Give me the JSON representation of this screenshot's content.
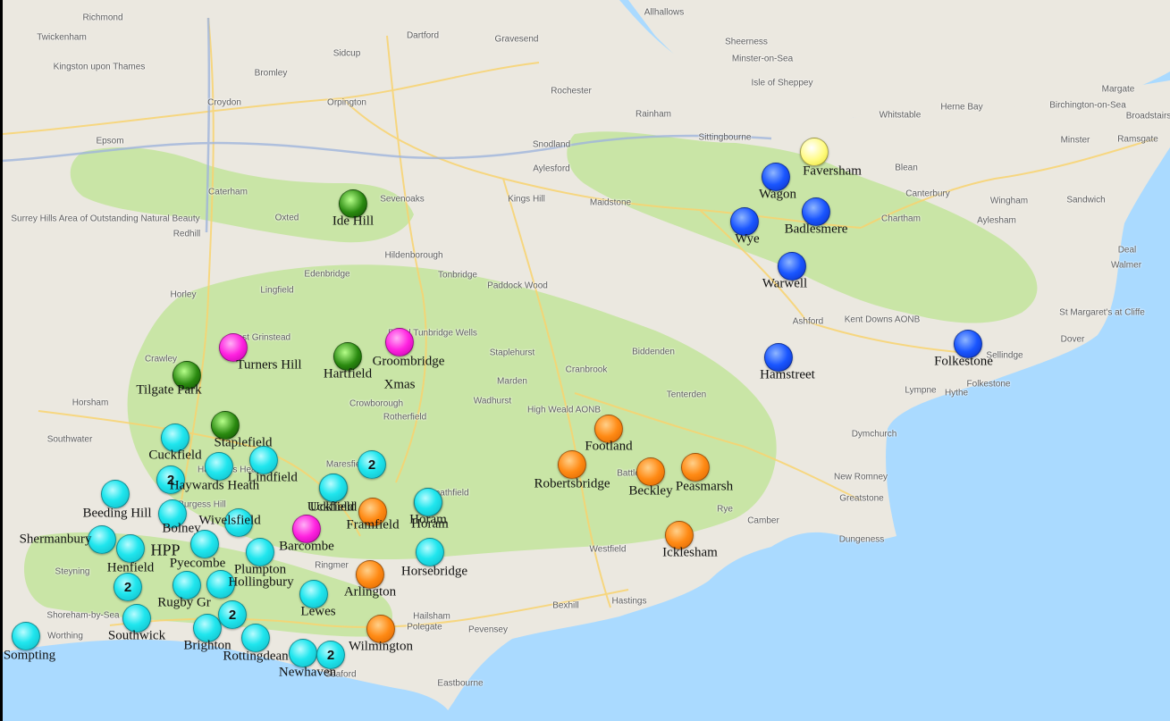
{
  "colors": {
    "sea": "#aadaff",
    "land": "#ebe8e0",
    "green_area": "#c9e5a6",
    "cyan": "#20e6ee",
    "orange": "#ff8a14",
    "blue": "#1a56ff",
    "green": "#2a8a10",
    "magenta": "#ff22e0",
    "yellow": "#fffb80"
  },
  "place_names": [
    "Richmond",
    "Twickenham",
    "Kingston upon Thames",
    "Epsom",
    "Croydon",
    "Bromley",
    "Dartford",
    "Gravesend",
    "Sidcup",
    "Orpington",
    "Rochester",
    "Allhallows",
    "Sheerness",
    "Minster-on-Sea",
    "Isle of Sheppey",
    "Whitstable",
    "Herne Bay",
    "Birchington-on-Sea",
    "Margate",
    "Broadstairs",
    "Ramsgate",
    "Minster",
    "Sittingbourne",
    "Rainham",
    "Snodland",
    "Aylesford",
    "Maidstone",
    "Sevenoaks",
    "Oxted",
    "Redhill",
    "Caterham",
    "Surrey Hills Area of Outstanding Natural Beauty",
    "Hildenborough",
    "Tonbridge",
    "Edenbridge",
    "Paddock Wood",
    "Kings Hill",
    "Royal Tunbridge Wells",
    "Horley",
    "Lingfield",
    "Crawley",
    "East Grinstead",
    "Horsham",
    "Southwater",
    "Crowborough",
    "Rotherfield",
    "Wadhurst",
    "Cranbrook",
    "Tenterden",
    "Biddenden",
    "Staplehurst",
    "Marden",
    "High Weald AONB",
    "Ashford",
    "Kent Downs AONB",
    "Sellindge",
    "Lympne",
    "Hythe",
    "Folkestone",
    "Dover",
    "St Margaret's at Cliffe",
    "Deal",
    "Walmer",
    "Sandwich",
    "Wingham",
    "Canterbury",
    "Blean",
    "Chartham",
    "Aylesham",
    "Dymchurch",
    "New Romney",
    "Greatstone",
    "Camber",
    "Dungeness",
    "Rye",
    "Hastings",
    "Bexhill",
    "Battle",
    "Westfield",
    "Hailsham",
    "Polegate",
    "Pevensey",
    "Eastbourne",
    "Ringmer",
    "Seaford",
    "Steyning",
    "Shoreham-by-Sea",
    "Worthing",
    "Haywards Heath",
    "Burgess Hill",
    "Maresfield",
    "Heathfield"
  ],
  "markers": [
    {
      "color": "yellow",
      "count": "",
      "label": "Faversham"
    },
    {
      "color": "blue",
      "count": "",
      "label": "Wagon"
    },
    {
      "color": "blue",
      "count": "",
      "label": "Badlesmere"
    },
    {
      "color": "blue",
      "count": "",
      "label": "Wye"
    },
    {
      "color": "blue",
      "count": "",
      "label": "Warwell"
    },
    {
      "color": "blue",
      "count": "",
      "label": "Hamstreet"
    },
    {
      "color": "blue",
      "count": "",
      "label": "Folkestone"
    },
    {
      "color": "green",
      "count": "",
      "label": "Ide Hill"
    },
    {
      "color": "green",
      "count": "",
      "label": "Hartfield"
    },
    {
      "color": "green",
      "count": "",
      "label": "Tilgate Park"
    },
    {
      "color": "green",
      "count": "",
      "label": "Staplefield"
    },
    {
      "color": "magenta",
      "count": "",
      "label": "Turners Hill"
    },
    {
      "color": "magenta",
      "count": "",
      "label": "Groombridge"
    },
    {
      "color": "magenta",
      "count": "",
      "label": "Barcombe"
    },
    {
      "color": "orange",
      "count": "",
      "label": "Footland"
    },
    {
      "color": "orange",
      "count": "",
      "label": "Robertsbridge"
    },
    {
      "color": "orange",
      "count": "",
      "label": "Beckley"
    },
    {
      "color": "orange",
      "count": "",
      "label": "Peasmarsh"
    },
    {
      "color": "orange",
      "count": "",
      "label": "Icklesham"
    },
    {
      "color": "orange",
      "count": "",
      "label": "Framfield"
    },
    {
      "color": "orange",
      "count": "",
      "label": "Horam"
    },
    {
      "color": "orange",
      "count": "",
      "label": "Arlington"
    },
    {
      "color": "orange",
      "count": "",
      "label": "Wilmington"
    },
    {
      "color": "cyan",
      "count": "",
      "label": "Cuckfield"
    },
    {
      "color": "cyan",
      "count": "2",
      "label": ""
    },
    {
      "color": "cyan",
      "count": "",
      "label": "Haywards Heath"
    },
    {
      "color": "cyan",
      "count": "",
      "label": "Lindfield"
    },
    {
      "color": "cyan",
      "count": "",
      "label": "Beeding Hill"
    },
    {
      "color": "cyan",
      "count": "",
      "label": "Bolney"
    },
    {
      "color": "cyan",
      "count": "",
      "label": "Wivelsfield"
    },
    {
      "color": "cyan",
      "count": "",
      "label": "Shermanbury"
    },
    {
      "color": "cyan",
      "count": "",
      "label": "Henfield"
    },
    {
      "color": "cyan",
      "count": "",
      "label": "Pyecombe"
    },
    {
      "color": "cyan",
      "count": "",
      "label": "Plumpton"
    },
    {
      "color": "cyan",
      "count": "",
      "label": "Hollingbury"
    },
    {
      "color": "cyan",
      "count": "2",
      "label": ""
    },
    {
      "color": "cyan",
      "count": "",
      "label": "Rugby Gr"
    },
    {
      "color": "cyan",
      "count": "",
      "label": "Southwick"
    },
    {
      "color": "cyan",
      "count": "",
      "label": "Brighton"
    },
    {
      "color": "cyan",
      "count": "2",
      "label": ""
    },
    {
      "color": "cyan",
      "count": "",
      "label": "Rottingdean"
    },
    {
      "color": "cyan",
      "count": "",
      "label": "Sompting"
    },
    {
      "color": "cyan",
      "count": "",
      "label": "Lewes"
    },
    {
      "color": "cyan",
      "count": "",
      "label": "Newhaven"
    },
    {
      "color": "cyan",
      "count": "2",
      "label": ""
    },
    {
      "color": "cyan",
      "count": "2",
      "label": ""
    },
    {
      "color": "cyan",
      "count": "",
      "label": "Uckfield"
    },
    {
      "color": "cyan",
      "count": "",
      "label": "Uckfield"
    },
    {
      "color": "cyan",
      "count": "",
      "label": "Horsebridge"
    },
    {
      "color": "cyan",
      "count": "",
      "label": "Horam"
    }
  ],
  "extra_labels": [
    "Xmas",
    "HPP"
  ]
}
